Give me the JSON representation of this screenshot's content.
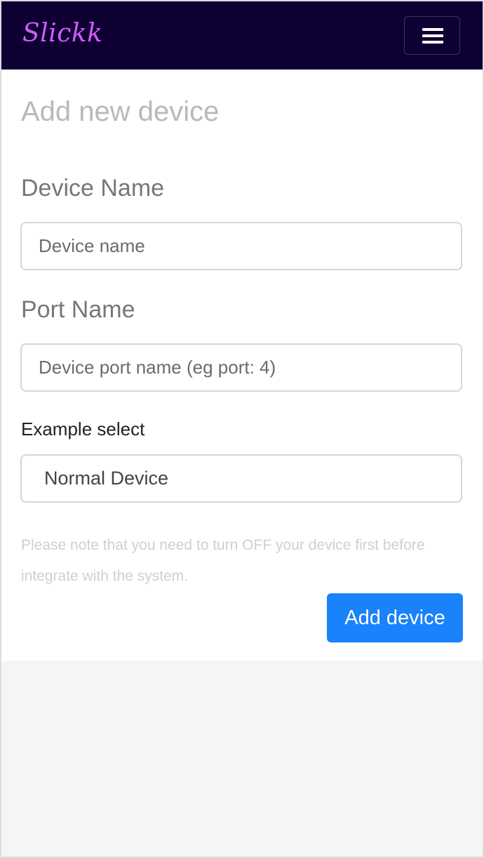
{
  "navbar": {
    "brand": "Slickk",
    "menu_icon": "hamburger-menu-icon",
    "background_color": "#0e0033",
    "brand_color": "#d35bff"
  },
  "form": {
    "title": "Add new device",
    "device_name": {
      "label": "Device Name",
      "value": "",
      "placeholder": "Device name"
    },
    "port_name": {
      "label": "Port Name",
      "value": "",
      "placeholder": "Device port name (eg port: 4)"
    },
    "device_type": {
      "label": "Example select",
      "selected": "Normal Device"
    },
    "note": "Please note that you need to turn OFF your device first before integrate with the system.",
    "submit_label": "Add device",
    "submit_color": "#1a82fb"
  }
}
